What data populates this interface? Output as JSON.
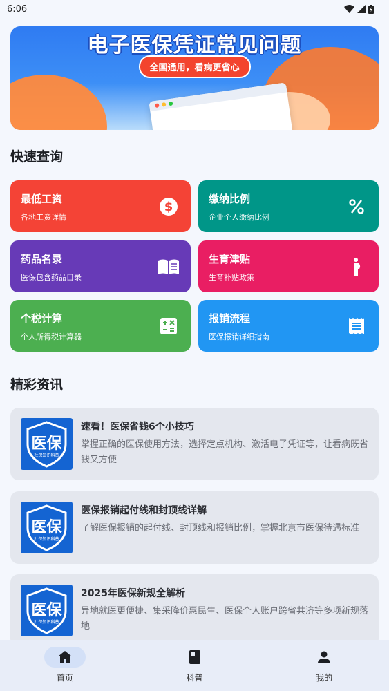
{
  "status": {
    "time": "6:06"
  },
  "banner": {
    "title": "电子医保凭证常见问题",
    "subtitle": "全国通用，看病更省心"
  },
  "quick": {
    "title": "快速查询",
    "items": [
      {
        "title": "最低工资",
        "sub": "各地工资详情",
        "icon": "dollar-icon",
        "color": "#f44336"
      },
      {
        "title": "缴纳比例",
        "sub": "企业个人缴纳比例",
        "icon": "percent-icon",
        "color": "#009688"
      },
      {
        "title": "药品名录",
        "sub": "医保包含药品目录",
        "icon": "book-icon",
        "color": "#673ab7"
      },
      {
        "title": "生育津贴",
        "sub": "生育补贴政策",
        "icon": "pregnant-icon",
        "color": "#e91e63"
      },
      {
        "title": "个税计算",
        "sub": "个人所得税计算器",
        "icon": "calculator-icon",
        "color": "#4caf50"
      },
      {
        "title": "报销流程",
        "sub": "医保报销详细指南",
        "icon": "receipt-icon",
        "color": "#2196f3"
      }
    ]
  },
  "news": {
    "title": "精彩资讯",
    "thumb_text": "医保",
    "thumb_caption": "社保知识科普",
    "items": [
      {
        "title": "速看！医保省钱6个小技巧",
        "desc": "掌握正确的医保使用方法，选择定点机构、激活电子凭证等，让看病既省钱又方便"
      },
      {
        "title": "医保报销起付线和封顶线详解",
        "desc": "了解医保报销的起付线、封顶线和报销比例，掌握北京市医保待遇标准"
      },
      {
        "title": "2025年医保新规全解析",
        "desc": "异地就医更便捷、集采降价惠民生、医保个人账户跨省共济等多项新规落地"
      }
    ]
  },
  "nav": {
    "items": [
      {
        "label": "首页",
        "icon": "home-icon"
      },
      {
        "label": "科普",
        "icon": "book-icon"
      },
      {
        "label": "我的",
        "icon": "person-icon"
      }
    ]
  }
}
